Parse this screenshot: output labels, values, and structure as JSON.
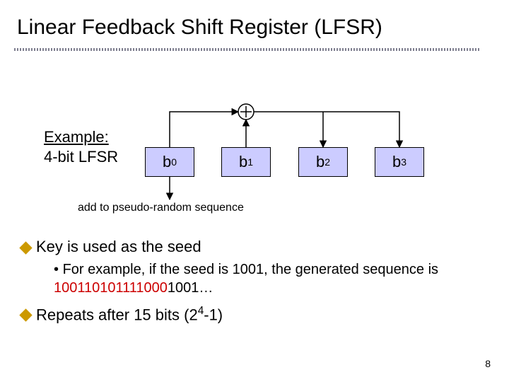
{
  "title": "Linear Feedback Shift Register (LFSR)",
  "example_l1": "Example:",
  "example_l2": "4-bit LFSR",
  "bits": {
    "b0": "b",
    "b0s": "0",
    "b1": "b",
    "b1s": "1",
    "b2": "b",
    "b2s": "2",
    "b3": "b",
    "b3s": "3"
  },
  "addline": "add to pseudo-random sequence",
  "bullet1": "Key is used as the seed",
  "sub1a": "For example, if the seed is 1001, the generated sequence is ",
  "sub1b": "100110101111000",
  "sub1c": "1001…",
  "bullet2_a": "Repeats after 15 bits (2",
  "bullet2_sup": "4",
  "bullet2_b": "-1)",
  "page": "8"
}
